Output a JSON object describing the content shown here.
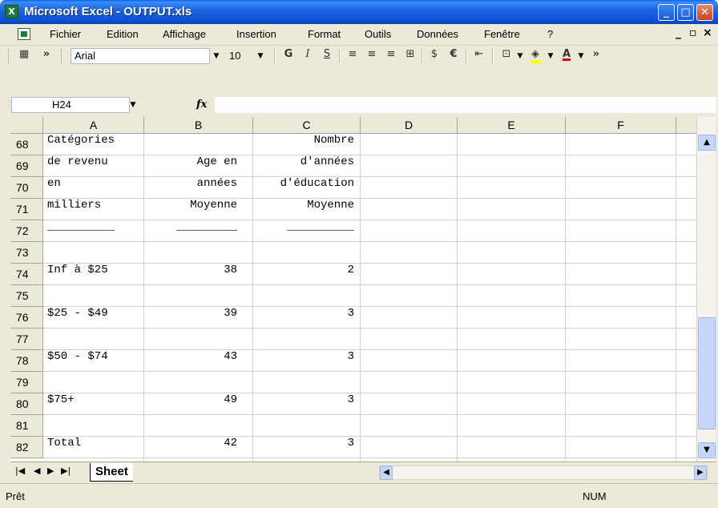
{
  "window": {
    "title": "Microsoft Excel - OUTPUT.xls"
  },
  "menu": {
    "items": [
      "Fichier",
      "Edition",
      "Affichage",
      "Insertion",
      "Format",
      "Outils",
      "Données",
      "Fenêtre",
      "?"
    ]
  },
  "toolbar": {
    "font_name": "Arial",
    "font_size": "10",
    "bold_label": "G",
    "italic_label": "I",
    "underline_label": "S",
    "currency_label": "€",
    "font_color": "#e00000",
    "fill_color": "#ffff00"
  },
  "formula_bar": {
    "name_box": "H24",
    "fx_label": "fx",
    "formula": ""
  },
  "sheet": {
    "columns": [
      "A",
      "B",
      "C",
      "D",
      "E",
      "F"
    ],
    "rows": [
      {
        "num": "68",
        "a": "Catégories",
        "b": "",
        "c": "Nombre"
      },
      {
        "num": "69",
        "a": "de revenu",
        "b": "Age en",
        "c": "d'années"
      },
      {
        "num": "70",
        "a": "en",
        "b": "années",
        "c": "d'éducation"
      },
      {
        "num": "71",
        "a": "milliers",
        "b": "Moyenne",
        "c": "Moyenne"
      },
      {
        "num": "72",
        "a": "__________",
        "b": "_________",
        "c": "__________"
      },
      {
        "num": "73",
        "a": "",
        "b": "",
        "c": ""
      },
      {
        "num": "74",
        "a": "Inf à $25",
        "b": "38",
        "c": "2"
      },
      {
        "num": "75",
        "a": "",
        "b": "",
        "c": ""
      },
      {
        "num": "76",
        "a": "$25 - $49",
        "b": "39",
        "c": "3"
      },
      {
        "num": "77",
        "a": "",
        "b": "",
        "c": ""
      },
      {
        "num": "78",
        "a": "$50 - $74",
        "b": "43",
        "c": "3"
      },
      {
        "num": "79",
        "a": "",
        "b": "",
        "c": ""
      },
      {
        "num": "80",
        "a": "$75+",
        "b": "49",
        "c": "3"
      },
      {
        "num": "81",
        "a": "",
        "b": "",
        "c": ""
      },
      {
        "num": "82",
        "a": "Total",
        "b": "42",
        "c": "3"
      }
    ],
    "tab_name": "Sheet"
  },
  "status": {
    "left": "Prêt",
    "right": "NUM"
  }
}
